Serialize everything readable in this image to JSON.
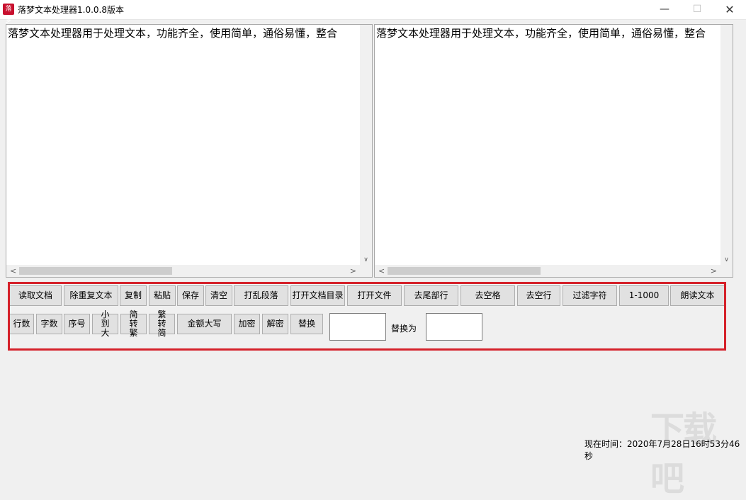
{
  "window": {
    "title": "落梦文本处理器1.0.0.8版本",
    "icon_label": "落梦",
    "minimize_glyph": "—",
    "maximize_glyph": "☐",
    "close_glyph": "✕"
  },
  "editors": {
    "left_text": "落梦文本处理器用于处理文本，功能齐全，使用简单，通俗易懂，整合",
    "right_text": "落梦文本处理器用于处理文本，功能齐全，使用简单，通俗易懂，整合"
  },
  "toolbar": {
    "row1": [
      "读取文档",
      "除重复文本",
      "复制",
      "粘贴",
      "保存",
      "清空",
      "打乱段落",
      "打开文档目录",
      "打开文件",
      "去尾部行",
      "去空格",
      "去空行",
      "过滤字符",
      "1-1000",
      "朗读文本"
    ],
    "row2": [
      "行数",
      "字数",
      "序号",
      "小到大",
      "简转繁",
      "繁转简",
      "金额大写",
      "加密",
      "解密",
      "替换"
    ],
    "replace_label": "替换为",
    "find_value": "",
    "replace_value": ""
  },
  "status": {
    "time_text": "现在时间：2020年7月28日16时53分46秒"
  },
  "watermark": {
    "text": "下载吧"
  },
  "colors": {
    "highlight": "#d5212a",
    "button_bg": "#e1e1e1"
  }
}
